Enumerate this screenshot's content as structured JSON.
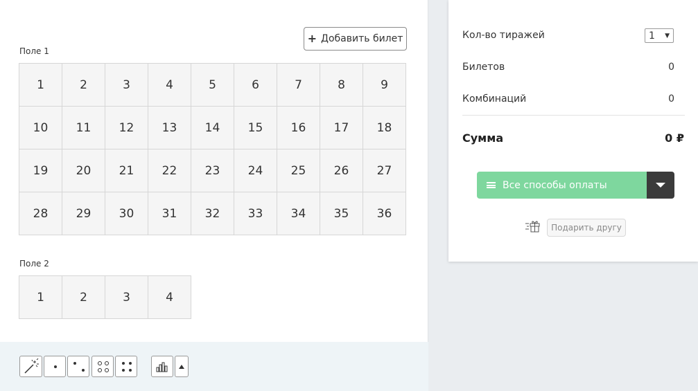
{
  "ticket": {
    "add_button_label": "Добавить билет",
    "field1": {
      "label": "Поле 1",
      "numbers": [
        "1",
        "2",
        "3",
        "4",
        "5",
        "6",
        "7",
        "8",
        "9",
        "10",
        "11",
        "12",
        "13",
        "14",
        "15",
        "16",
        "17",
        "18",
        "19",
        "20",
        "21",
        "22",
        "23",
        "24",
        "25",
        "26",
        "27",
        "28",
        "29",
        "30",
        "31",
        "32",
        "33",
        "34",
        "35",
        "36"
      ]
    },
    "field2": {
      "label": "Поле 2",
      "numbers": [
        "1",
        "2",
        "3",
        "4"
      ]
    }
  },
  "toolbar": {
    "buttons": [
      "magic-wand-icon",
      "one-dot-icon",
      "two-dots-icon",
      "four-circles-icon",
      "four-dots-icon",
      "bar-chart-icon",
      "arrow-up-icon"
    ]
  },
  "summary": {
    "draws_label": "Кол-во тиражей",
    "draws_value": "1",
    "tickets_label": "Билетов",
    "tickets_value": "0",
    "combinations_label": "Комбинаций",
    "combinations_value": "0",
    "sum_label": "Сумма",
    "sum_value": "0 ₽",
    "pay_button_label": "Все способы оплаты",
    "gift_button_label": "Подарить другу"
  },
  "colors": {
    "pay_green": "#7ed79e",
    "pay_dark": "#3b3b3b",
    "cell_bg": "#f5f5f5",
    "toolbar_bg": "#eef4f7"
  }
}
